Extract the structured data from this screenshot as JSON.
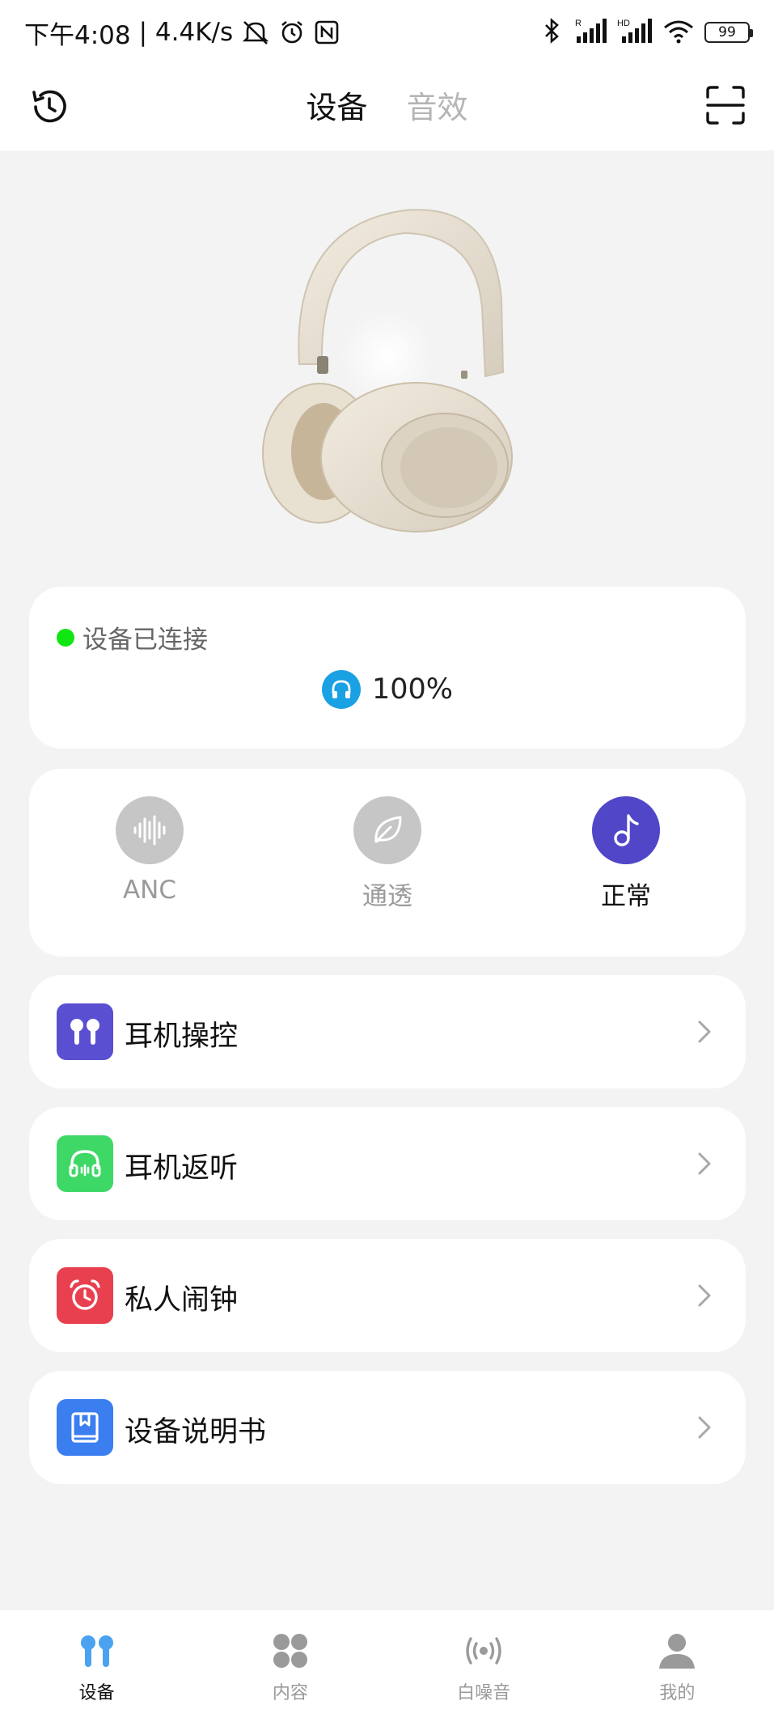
{
  "status_bar": {
    "time": "下午4:08",
    "net_speed": "| 4.4K/s",
    "battery": "99",
    "icons": [
      "mute-icon",
      "alarm-icon",
      "nfc-icon",
      "bluetooth-icon",
      "signal-r-icon",
      "signal-hd-icon",
      "wifi-icon"
    ]
  },
  "header": {
    "tabs": [
      {
        "label": "设备",
        "active": true
      },
      {
        "label": "音效",
        "active": false
      }
    ],
    "left_icon": "history-icon",
    "right_icon": "scan-icon"
  },
  "connection": {
    "status": "设备已连接",
    "battery_percent": "100%",
    "status_color": "#12e612"
  },
  "modes": [
    {
      "label": "ANC",
      "icon": "soundwave-icon",
      "active": false
    },
    {
      "label": "通透",
      "icon": "leaf-icon",
      "active": false
    },
    {
      "label": "正常",
      "icon": "music-note-icon",
      "active": true
    }
  ],
  "menu": [
    {
      "label": "耳机操控",
      "icon": "earbuds-icon",
      "color": "#5a4fd0"
    },
    {
      "label": "耳机返听",
      "icon": "headphones-icon",
      "color": "#3ed866"
    },
    {
      "label": "私人闹钟",
      "icon": "alarm-clock-icon",
      "color": "#e8404f"
    },
    {
      "label": "设备说明书",
      "icon": "book-icon",
      "color": "#3b7ef0"
    }
  ],
  "bottom_nav": [
    {
      "label": "设备",
      "icon": "earbuds-icon",
      "active": true
    },
    {
      "label": "内容",
      "icon": "grid-icon",
      "active": false
    },
    {
      "label": "白噪音",
      "icon": "broadcast-icon",
      "active": false
    },
    {
      "label": "我的",
      "icon": "user-icon",
      "active": false
    }
  ],
  "colors": {
    "accent": "#5146c8",
    "battery_icon": "#1aa1e4",
    "nav_active": "#4aa3f0"
  }
}
